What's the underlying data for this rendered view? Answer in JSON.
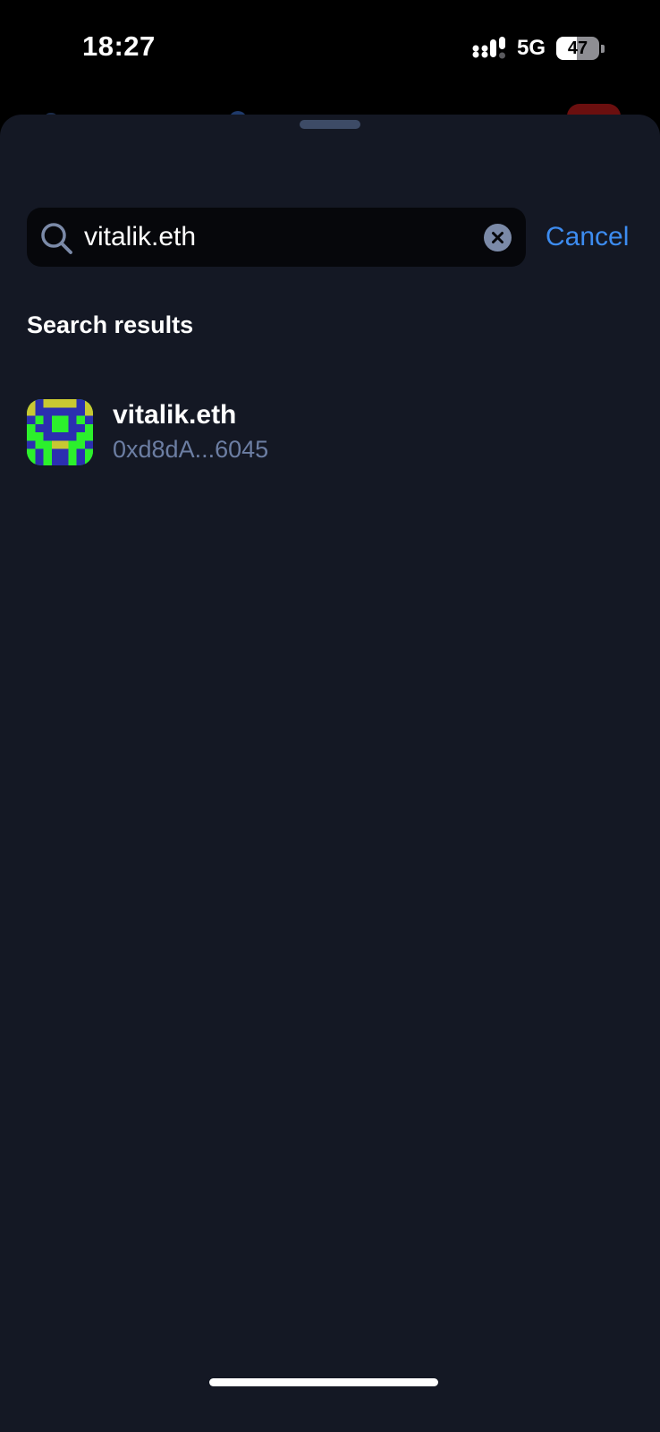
{
  "status_bar": {
    "time": "18:27",
    "network": "5G",
    "battery_level": "47"
  },
  "search": {
    "value": "vitalik.eth",
    "placeholder": "Search",
    "cancel_label": "Cancel"
  },
  "results": {
    "title": "Search results",
    "items": [
      {
        "name": "vitalik.eth",
        "address": "0xd8dA...6045"
      }
    ]
  },
  "colors": {
    "sheet_background": "#141824",
    "accent": "#3d8cf0",
    "secondary_text": "#6c7ea3"
  },
  "icons": [
    "search-icon",
    "clear-icon",
    "signal-icon",
    "battery-icon",
    "avatar-identicon"
  ]
}
